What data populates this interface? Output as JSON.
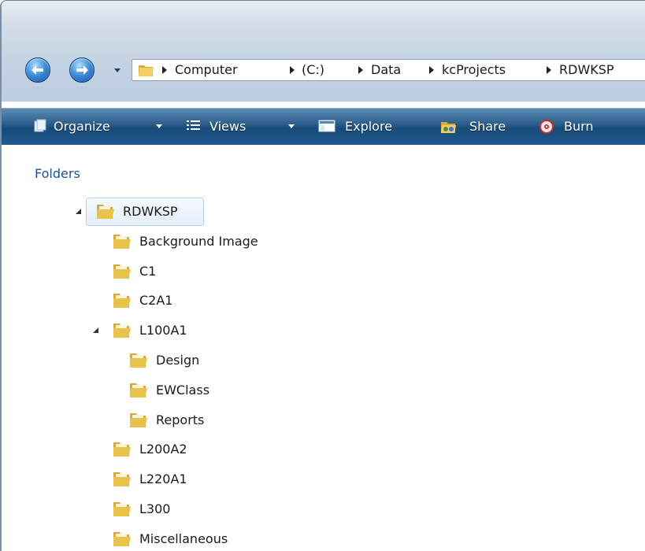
{
  "colors": {
    "toolbar": "#1f5a8c",
    "folder_yellow": "#e9c24a",
    "header_blue": "#1e4f9c",
    "selection": "#e3eff9"
  },
  "nav": {
    "back_icon": "back-arrow-icon",
    "forward_icon": "forward-arrow-icon"
  },
  "address": {
    "crumbs": [
      "Computer",
      "(C:)",
      "Data",
      "kcProjects",
      "RDWKSP"
    ]
  },
  "toolbar": {
    "organize": "Organize",
    "views": "Views",
    "explore": "Explore",
    "share": "Share",
    "burn": "Burn"
  },
  "pane": {
    "header": "Folders"
  },
  "tree": [
    {
      "label": "RDWKSP",
      "level": 0,
      "expanded": true,
      "selected": true
    },
    {
      "label": "Background Image",
      "level": 1
    },
    {
      "label": "C1",
      "level": 1
    },
    {
      "label": "C2A1",
      "level": 1
    },
    {
      "label": "L100A1",
      "level": 1,
      "expanded": true
    },
    {
      "label": "Design",
      "level": 2
    },
    {
      "label": "EWClass",
      "level": 2
    },
    {
      "label": "Reports",
      "level": 2
    },
    {
      "label": "L200A2",
      "level": 1
    },
    {
      "label": "L220A1",
      "level": 1
    },
    {
      "label": "L300",
      "level": 1
    },
    {
      "label": "Miscellaneous",
      "level": 1
    }
  ]
}
